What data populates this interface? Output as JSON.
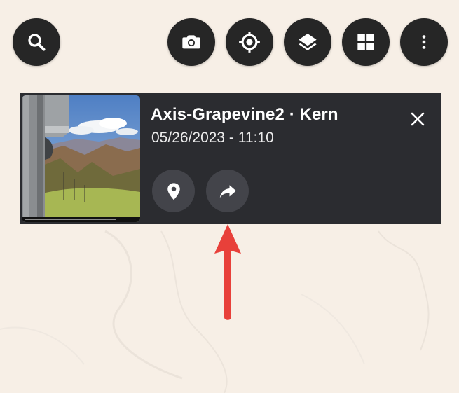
{
  "top_bar": {
    "search_icon": "search-icon",
    "camera_icon": "camera-icon",
    "locate_icon": "crosshair-icon",
    "layers_icon": "layers-icon",
    "grid_icon": "grid-icon",
    "more_icon": "more-vertical-icon"
  },
  "card": {
    "title": "Axis-Grapevine2 · Kern",
    "datetime": "05/26/2023 - 11:10",
    "close_icon": "close-icon",
    "actions": [
      {
        "icon": "map-pin-icon"
      },
      {
        "icon": "share-arrow-icon"
      }
    ]
  },
  "colors": {
    "button_bg": "#262626",
    "card_bg": "#2b2c30",
    "action_bg": "#43444a",
    "map_bg": "#f7efe6",
    "annotation_arrow": "#e8403a"
  }
}
